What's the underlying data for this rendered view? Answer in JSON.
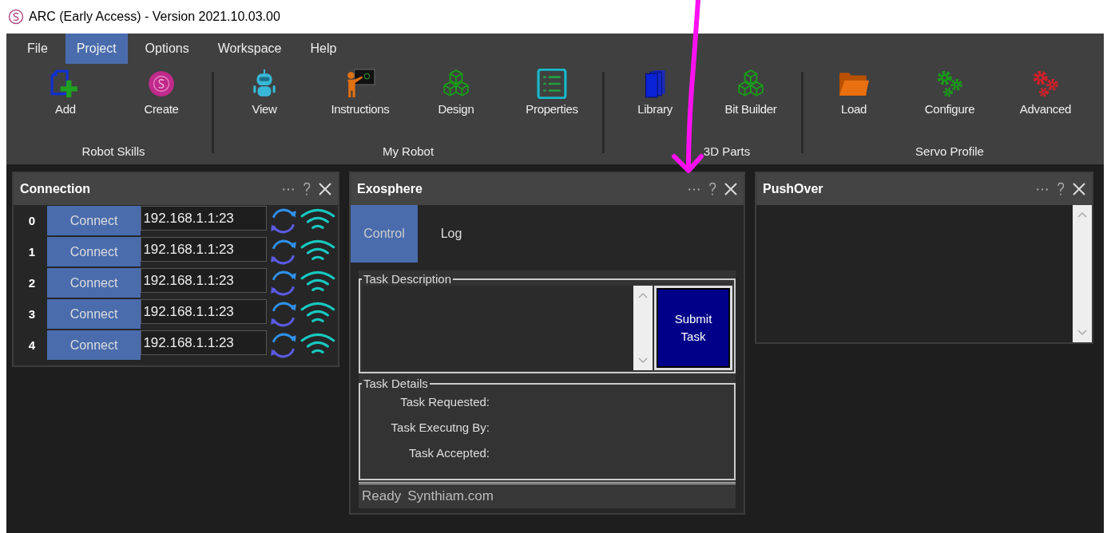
{
  "window": {
    "title": "ARC (Early Access) - Version 2021.10.03.00"
  },
  "menu": [
    {
      "label": "File",
      "selected": false
    },
    {
      "label": "Project",
      "selected": true
    },
    {
      "label": "Options",
      "selected": false
    },
    {
      "label": "Workspace",
      "selected": false
    },
    {
      "label": "Help",
      "selected": false
    }
  ],
  "toolbar_groups": [
    {
      "label": "Robot Skills",
      "items": [
        {
          "label": "Add",
          "kind": "add"
        },
        {
          "label": "Create",
          "kind": "create"
        }
      ]
    },
    {
      "label": "My Robot",
      "items": [
        {
          "label": "View",
          "kind": "robot"
        },
        {
          "label": "Instructions",
          "kind": "teacher"
        },
        {
          "label": "Design",
          "kind": "cubes"
        },
        {
          "label": "Properties",
          "kind": "list"
        }
      ]
    },
    {
      "label": "3D Parts",
      "items": [
        {
          "label": "Library",
          "kind": "books"
        },
        {
          "label": "Bit Builder",
          "kind": "cubes"
        }
      ]
    },
    {
      "label": "Servo Profile",
      "items": [
        {
          "label": "Load",
          "kind": "folder"
        },
        {
          "label": "Configure",
          "kind": "gears"
        },
        {
          "label": "Advanced",
          "kind": "redgears"
        }
      ]
    }
  ],
  "connection": {
    "title": "Connection",
    "rows": [
      {
        "index": "0",
        "button": "Connect",
        "address": "192.168.1.1:23"
      },
      {
        "index": "1",
        "button": "Connect",
        "address": "192.168.1.1:23"
      },
      {
        "index": "2",
        "button": "Connect",
        "address": "192.168.1.1:23"
      },
      {
        "index": "3",
        "button": "Connect",
        "address": "192.168.1.1:23"
      },
      {
        "index": "4",
        "button": "Connect",
        "address": "192.168.1.1:23"
      }
    ]
  },
  "exosphere": {
    "title": "Exosphere",
    "tabs": [
      {
        "label": "Control",
        "selected": true
      },
      {
        "label": "Log",
        "selected": false
      }
    ],
    "task_description": {
      "legend": "Task Description"
    },
    "submit_button": "Submit Task",
    "task_details": {
      "legend": "Task Details",
      "fields": [
        "Task Requested:",
        "Task Executng By:",
        "Task Accepted:"
      ]
    },
    "status": [
      "Ready",
      "Synthiam.com"
    ]
  },
  "pushover": {
    "title": "PushOver"
  }
}
